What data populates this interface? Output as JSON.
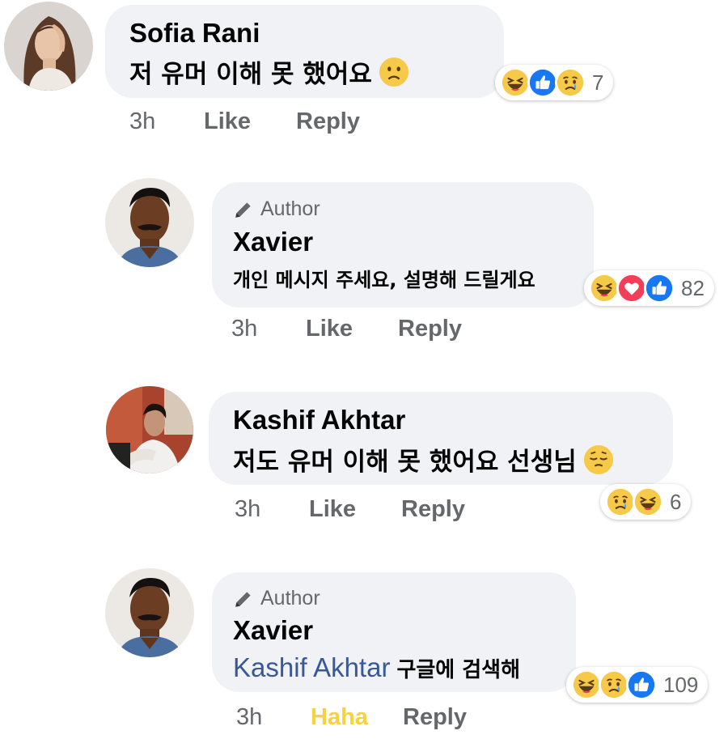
{
  "comments": [
    {
      "name": "Sofia Rani",
      "text": "저 유머 이해 못 했어요",
      "time": "3h",
      "action1": "Like",
      "reply": "Reply",
      "reaction_count": "7",
      "reactions": [
        "haha-icon",
        "like-icon",
        "sad-icon"
      ]
    },
    {
      "author_label": "Author",
      "name": "Xavier",
      "text": "개인 메시지 주세요, 설명해 드릴게요",
      "time": "3h",
      "action1": "Like",
      "reply": "Reply",
      "reaction_count": "82",
      "reactions": [
        "haha-icon",
        "love-icon",
        "like-icon"
      ]
    },
    {
      "name": "Kashif Akhtar",
      "text": "저도 유머 이해 못 했어요 선생님",
      "time": "3h",
      "action1": "Like",
      "reply": "Reply",
      "reaction_count": "6",
      "reactions": [
        "sad-icon",
        "haha-icon"
      ]
    },
    {
      "author_label": "Author",
      "name": "Xavier",
      "mention": "Kashif Akhtar",
      "text": "구글에 검색해",
      "time": "3h",
      "action1": "Haha",
      "reply": "Reply",
      "reaction_count": "109",
      "reactions": [
        "haha-icon",
        "sad-icon",
        "like-icon"
      ]
    }
  ],
  "colors": {
    "bubble": "#f0f2f5",
    "secondary_text": "#65676b",
    "mention": "#385898",
    "haha_action": "#f7d13f",
    "like_blue": "#1877f2",
    "love_red": "#f33e58",
    "emoji_yellow": "#f7c948"
  }
}
